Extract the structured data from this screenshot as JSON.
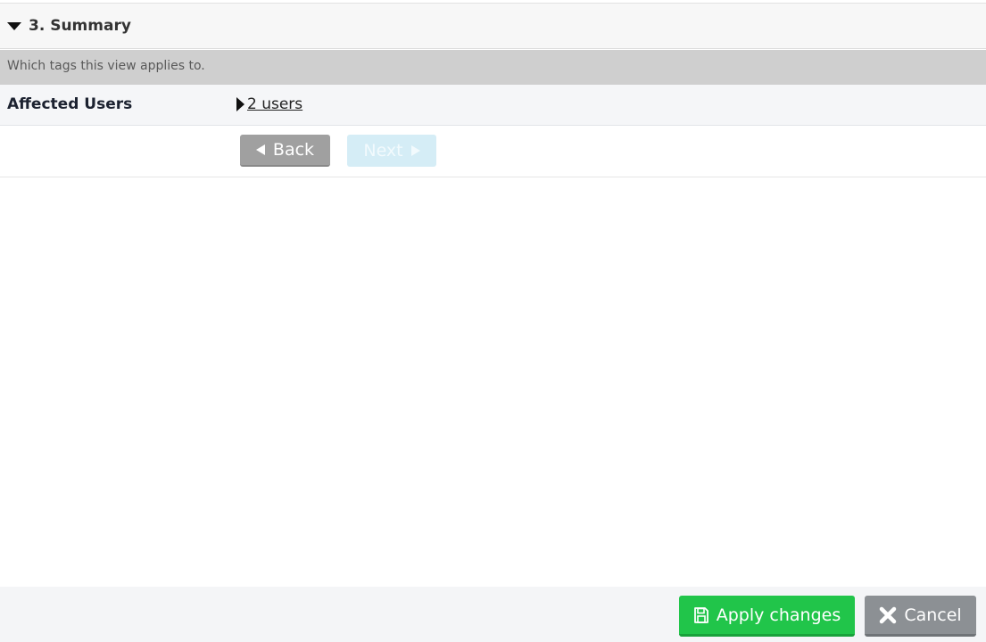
{
  "section": {
    "title": "3. Summary",
    "toggle_icon": "caret-down-icon",
    "description": "Which tags this view applies to."
  },
  "affected_users": {
    "label": "Affected Users",
    "expand_icon": "caret-right-icon",
    "link_text": "2 users"
  },
  "navigation": {
    "back_label": "Back",
    "back_icon": "triangle-left-icon",
    "next_label": "Next",
    "next_icon": "triangle-right-icon",
    "next_state": "disabled"
  },
  "footer": {
    "apply_label": "Apply changes",
    "apply_icon": "floppy-disk-icon",
    "cancel_label": "Cancel",
    "cancel_icon": "x-icon"
  },
  "colors": {
    "apply_green": "#21c54a",
    "cancel_gray": "#8c9094",
    "back_gray": "#a0a0a0",
    "next_disabled_blue": "#d5edf6",
    "description_bg": "#cfcfcf"
  }
}
